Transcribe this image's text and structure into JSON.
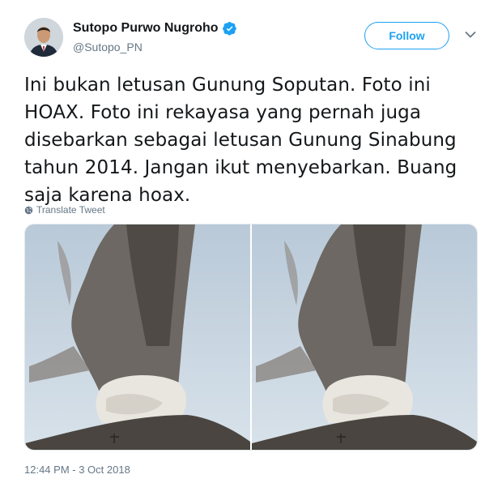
{
  "author": {
    "display_name": "Sutopo Purwo Nugroho",
    "handle": "@Sutopo_PN",
    "avatar_icon": "person-avatar-icon",
    "verified_icon": "verified-badge-icon",
    "verified_color": "#1da1f2"
  },
  "actions": {
    "follow_label": "Follow",
    "more_icon": "chevron-down-icon"
  },
  "tweet": {
    "lines": [
      "Ini bukan letusan Gunung Soputan. Foto ini",
      "HOAX. Foto ini rekayasa yang pernah juga",
      "disebarkan sebagai letusan Gunung Sinabung",
      "tahun 2014. Jangan ikut menyebarkan. Buang",
      "saja karena hoax."
    ],
    "translate_label": "Translate Tweet",
    "translate_icon": "globe-icon"
  },
  "media": {
    "photos": [
      {
        "subject": "volcano-eruption-photo"
      },
      {
        "subject": "volcano-eruption-photo"
      }
    ]
  },
  "timestamp": "12:44 PM - 3 Oct 2018",
  "colors": {
    "accent": "#1da1f2",
    "text": "#14171a",
    "muted": "#657786"
  }
}
